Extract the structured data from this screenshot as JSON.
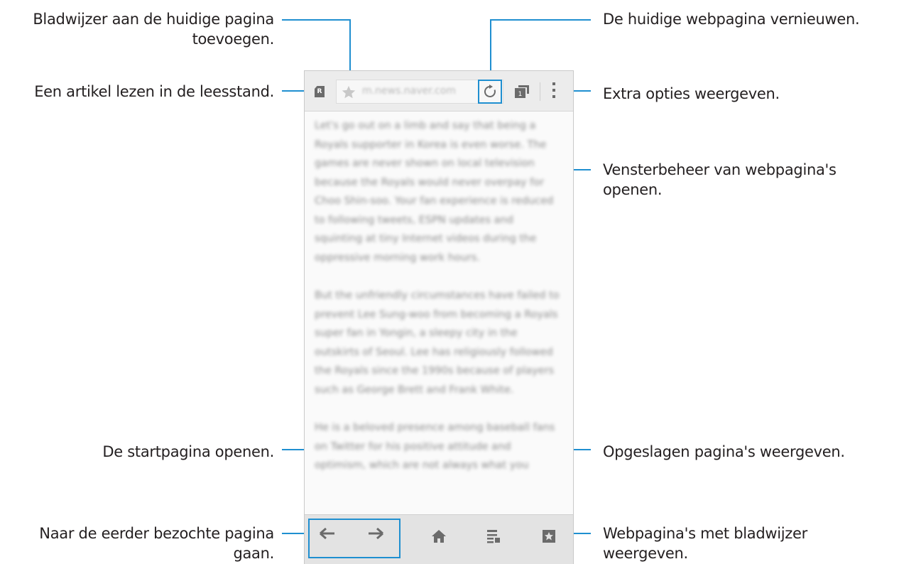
{
  "browser": {
    "url": "m.news.naver.com",
    "reader_badge": "R",
    "tab_count": "1",
    "article_paragraphs": [
      "Let's go out on a limb and say that being a Royals supporter in Korea is even worse. The games are never shown on local television because the Royals would never overpay for Choo Shin-soo. Your fan experience is reduced to following tweets, ESPN updates and squinting at tiny Internet videos during the oppressive morning work hours.",
      "But the unfriendly circumstances have failed to prevent Lee Sung-woo from becoming a Royals super fan in Yongin, a sleepy city in the outskirts of Seoul. Lee has religiously followed the Royals since the 1990s because of players such as George Brett and Frank White.",
      "He is a beloved presence among baseball fans on Twitter for his positive attitude and optimism, which are not always what you"
    ]
  },
  "callouts": {
    "bookmark_add": [
      "Bladwijzer aan de huidige pagina",
      "toevoegen."
    ],
    "reader_mode": "Een artikel lezen in de leesstand.",
    "refresh": "De huidige webpagina vernieuwen.",
    "more_options": "Extra opties weergeven.",
    "window_manager": [
      "Vensterbeheer van webpagina's",
      "openen."
    ],
    "home": "De startpagina openen.",
    "back_forward": [
      "Naar de eerder bezochte pagina",
      "gaan."
    ],
    "saved_pages": "Opgeslagen pagina's weergeven.",
    "bookmarks": [
      "Webpagina's met bladwijzer",
      "weergeven."
    ]
  },
  "colors": {
    "accent": "#1f8fd0",
    "icon": "#6b6b6b",
    "text": "#231f20"
  }
}
